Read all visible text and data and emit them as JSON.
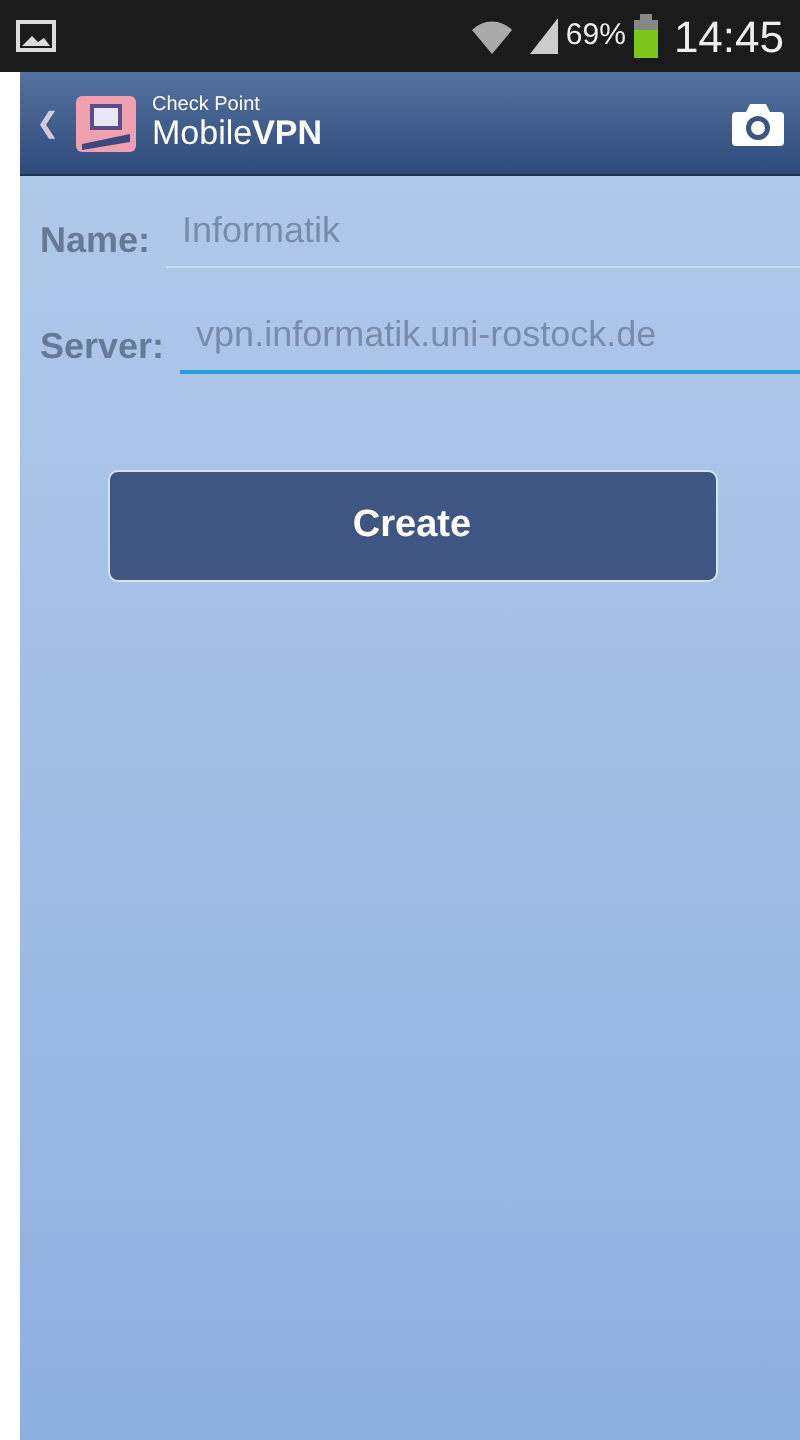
{
  "status_bar": {
    "battery": "69%",
    "time": "14:45"
  },
  "app_bar": {
    "back": "❮",
    "brand_small": "Check Point",
    "brand_light": "Mobile",
    "brand_bold": "VPN"
  },
  "fields": [
    {
      "label": "Name:",
      "value": "Informatik",
      "focused": false
    },
    {
      "label": "Server:",
      "value": "vpn.informatik.uni-rostock.de",
      "focused": true
    }
  ],
  "button": "Create"
}
